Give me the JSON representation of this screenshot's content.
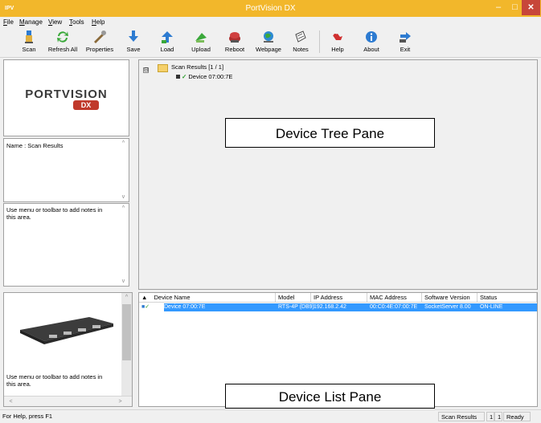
{
  "window": {
    "app_icon_text": "IPV",
    "title": "PortVision DX",
    "minimize": "–",
    "maximize": "□",
    "close": "✕"
  },
  "menu": [
    "File",
    "Manage",
    "View",
    "Tools",
    "Help"
  ],
  "toolbar": [
    {
      "label": "Scan",
      "icon": "scan-icon"
    },
    {
      "label": "Refresh All",
      "icon": "refresh-icon"
    },
    {
      "label": "Properties",
      "icon": "properties-icon"
    },
    {
      "label": "Save",
      "icon": "save-icon"
    },
    {
      "label": "Load",
      "icon": "load-icon"
    },
    {
      "label": "Upload",
      "icon": "upload-icon"
    },
    {
      "label": "Reboot",
      "icon": "reboot-icon"
    },
    {
      "label": "Webpage",
      "icon": "webpage-icon"
    },
    {
      "label": "Notes",
      "icon": "notes-icon"
    },
    {
      "label": "Help",
      "icon": "help-icon"
    },
    {
      "label": "About",
      "icon": "about-icon"
    },
    {
      "label": "Exit",
      "icon": "exit-icon"
    }
  ],
  "logo": {
    "text": "PORTVISION",
    "badge": "DX"
  },
  "name_pane": {
    "text": "Name : Scan Results"
  },
  "notes_pane": {
    "text": "Use menu or toolbar to add notes in this area."
  },
  "image_pane_notes": {
    "text": "Use menu or toolbar to add notes in this area."
  },
  "tree": {
    "root_label": "Scan Results [1 / 1]",
    "child_label": "Device 07:00:7E",
    "expander": "⊟"
  },
  "callouts": {
    "tree": "Device Tree Pane",
    "list": "Device List Pane"
  },
  "list": {
    "columns": [
      "Device Name",
      "Model",
      "IP Address",
      "MAC Address",
      "Software Version",
      "Status"
    ],
    "rows": [
      {
        "name": "Device 07:00:7E",
        "model": "RTS-4P (DB9)",
        "ip": "192.168.2.42",
        "mac": "00:C0:4E:07:00:7E",
        "software": "SocketServer 8.00",
        "status": "ON-LINE"
      }
    ]
  },
  "status": {
    "help": "For Help, press F1",
    "scan": "Scan Results",
    "count_a": "1",
    "count_b": "1",
    "ready": "Ready"
  },
  "colors": {
    "titlebar": "#f2b72b",
    "selection": "#3399ff",
    "close": "#c7463a"
  }
}
